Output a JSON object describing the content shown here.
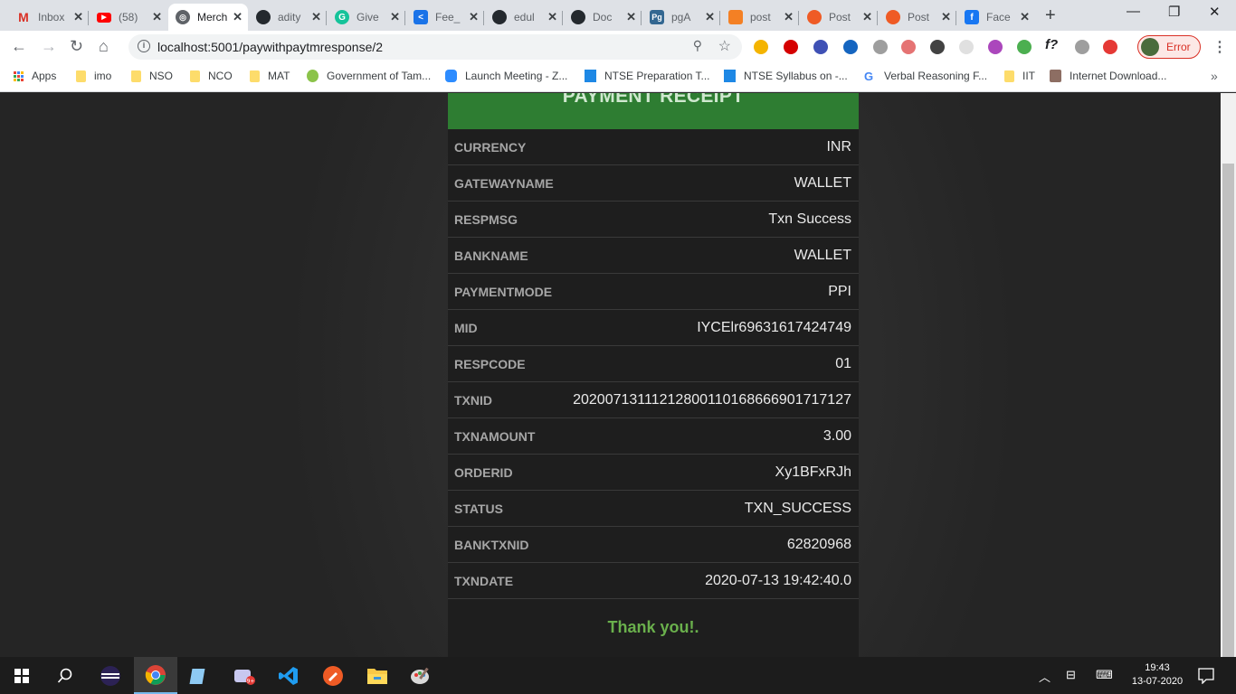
{
  "tabs": [
    {
      "title": "Inbox",
      "favicon": "gmail-icon",
      "color": "#d93025"
    },
    {
      "title": "(58)",
      "favicon": "youtube-icon",
      "color": "#ff0000"
    },
    {
      "title": "Merch",
      "favicon": "globe-icon",
      "color": "#5f6368",
      "active": true
    },
    {
      "title": "adity",
      "favicon": "github-icon",
      "color": "#24292e"
    },
    {
      "title": "Give",
      "favicon": "grammarly-icon",
      "color": "#15c39a"
    },
    {
      "title": "Fee_",
      "favicon": "share-icon",
      "color": "#1a73e8"
    },
    {
      "title": "edul",
      "favicon": "github-icon",
      "color": "#24292e"
    },
    {
      "title": "Doc",
      "favicon": "github-icon",
      "color": "#24292e"
    },
    {
      "title": "pgA",
      "favicon": "pg-icon",
      "color": "#336791"
    },
    {
      "title": "post",
      "favicon": "stackoverflow-icon",
      "color": "#f48024"
    },
    {
      "title": "Post",
      "favicon": "postman-icon",
      "color": "#ef5b25"
    },
    {
      "title": "Post",
      "favicon": "postman-icon",
      "color": "#ef5b25"
    },
    {
      "title": "Face",
      "favicon": "facebook-icon",
      "color": "#1877f2"
    }
  ],
  "toolbar": {
    "url": "localhost:5001/paywithpaytmresponse/2",
    "profile_label": "Error"
  },
  "bookmarks": [
    {
      "label": "Apps",
      "icon": "apps-icon"
    },
    {
      "label": "imo",
      "icon": "folder-icon"
    },
    {
      "label": "NSO",
      "icon": "folder-icon"
    },
    {
      "label": "NCO",
      "icon": "folder-icon"
    },
    {
      "label": "MAT",
      "icon": "folder-icon"
    },
    {
      "label": "Government of Tam...",
      "icon": "emblem-icon"
    },
    {
      "label": "Launch Meeting - Z...",
      "icon": "zoom-icon"
    },
    {
      "label": "NTSE Preparation T...",
      "icon": "sl-icon"
    },
    {
      "label": "NTSE Syllabus on -...",
      "icon": "sl-icon"
    },
    {
      "label": "Verbal Reasoning F...",
      "icon": "google-icon"
    },
    {
      "label": "IIT",
      "icon": "folder-icon"
    },
    {
      "label": "Internet Download...",
      "icon": "avatar-icon"
    }
  ],
  "receipt": {
    "title": "PAYMENT RECEIPT",
    "rows": [
      {
        "key": "CURRENCY",
        "value": "INR"
      },
      {
        "key": "GATEWAYNAME",
        "value": "WALLET"
      },
      {
        "key": "RESPMSG",
        "value": "Txn Success"
      },
      {
        "key": "BANKNAME",
        "value": "WALLET"
      },
      {
        "key": "PAYMENTMODE",
        "value": "PPI"
      },
      {
        "key": "MID",
        "value": "IYCElr69631617424749"
      },
      {
        "key": "RESPCODE",
        "value": "01"
      },
      {
        "key": "TXNID",
        "value": "20200713111212800110168666901717127"
      },
      {
        "key": "TXNAMOUNT",
        "value": "3.00"
      },
      {
        "key": "ORDERID",
        "value": "Xy1BFxRJh"
      },
      {
        "key": "STATUS",
        "value": "TXN_SUCCESS"
      },
      {
        "key": "BANKTXNID",
        "value": "62820968"
      },
      {
        "key": "TXNDATE",
        "value": "2020-07-13 19:42:40.0"
      }
    ],
    "footer": "Thank you!.",
    "header_color": "#2e7d32",
    "footer_color": "#6ab04c"
  },
  "taskbar": {
    "time": "19:43",
    "date": "13-07-2020"
  }
}
